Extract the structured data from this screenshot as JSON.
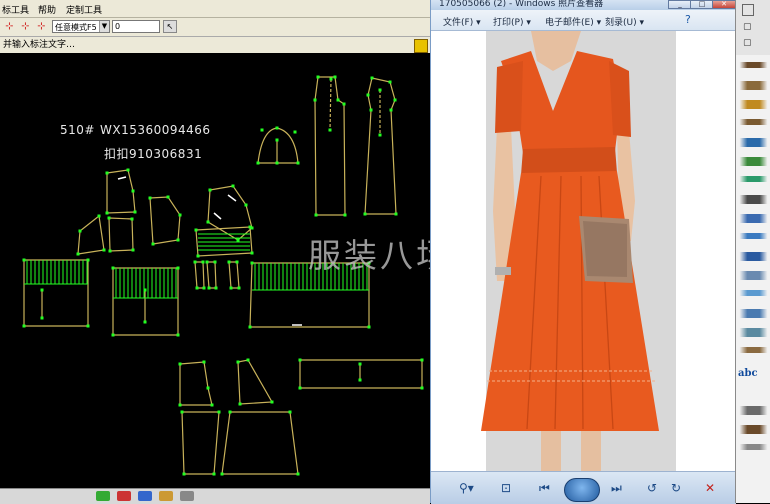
{
  "cad": {
    "menu": [
      "标工具",
      "帮助",
      "定制工具"
    ],
    "mode_select": "任意模式F5",
    "value_input": "0",
    "status_prompt": "并输入标注文字…",
    "annotations": {
      "size_label": "510#",
      "wx": "WX15360094466",
      "qq": "扣扣910306831"
    },
    "watermark": "服装八场"
  },
  "viewer": {
    "title": "170505066 (2) - Windows 照片查看器",
    "menu": {
      "file": "文件(F)",
      "print": "打印(P)",
      "email": "电子邮件(E)",
      "burn": "刻录(U)"
    },
    "photo": "orange v-neck pleated midi dress with clutch",
    "controls": [
      "zoom-icon",
      "fit-icon",
      "previous-icon",
      "slideshow-icon",
      "next-icon",
      "rotate-left-icon",
      "rotate-right-icon",
      "delete-icon"
    ]
  },
  "toolbox": {
    "label": "abc"
  },
  "colors": {
    "cad_bg": "#000000",
    "pattern_line": "#c8b25a",
    "point": "#22ff22",
    "dress": "#e5561e"
  }
}
